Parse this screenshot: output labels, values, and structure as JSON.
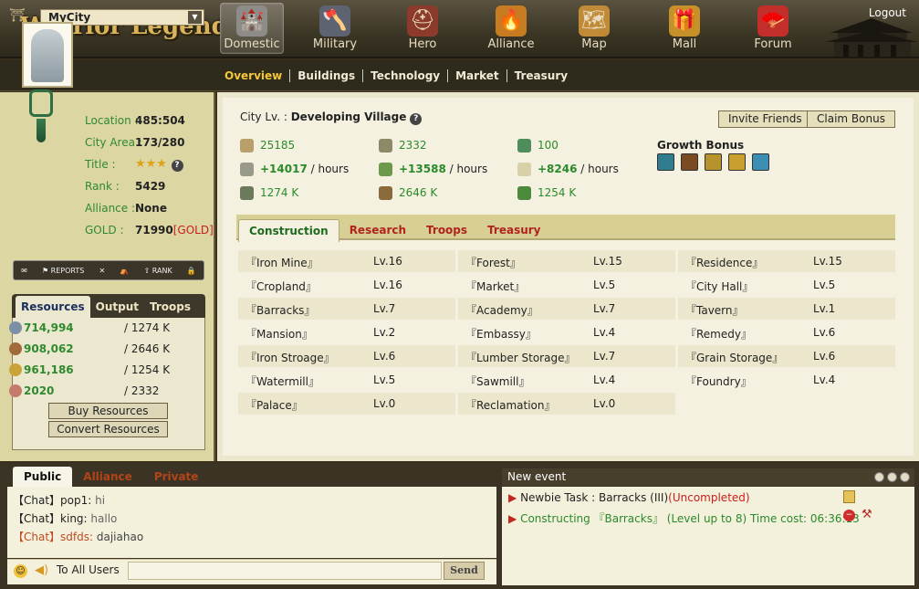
{
  "app": {
    "logo": "Warrior Legends",
    "logout": "Logout"
  },
  "nav": [
    {
      "label": "Domestic",
      "icon": "castle-icon",
      "active": true
    },
    {
      "label": "Military",
      "icon": "axe-icon"
    },
    {
      "label": "Hero",
      "icon": "helmet-icon"
    },
    {
      "label": "Alliance",
      "icon": "fire-icon"
    },
    {
      "label": "Map",
      "icon": "scroll-map-icon"
    },
    {
      "label": "Mall",
      "icon": "treasure-chest-icon"
    },
    {
      "label": "Forum",
      "icon": "fan-icon"
    }
  ],
  "city_select": {
    "value": "MyCity"
  },
  "subnav": [
    "Overview",
    "Buildings",
    "Technology",
    "Market",
    "Treasury"
  ],
  "profile": {
    "location_label": "Location :",
    "location": "485:504",
    "area_label": "City Area :",
    "area": "173/280",
    "title_label": "Title :",
    "title_stars": 3,
    "rank_label": "Rank :",
    "rank": "5429",
    "alliance_label": "Alliance :",
    "alliance": "None",
    "gold_label": "GOLD :",
    "gold": "71990",
    "gold_link": "[GOLD]"
  },
  "toolbar": [
    "REPORTS",
    "RANK"
  ],
  "res_tabs": [
    "Resources",
    "Output",
    "Troops"
  ],
  "resources": [
    {
      "value": "714,994",
      "cap": "/  1274 K",
      "icon": "stone-icon"
    },
    {
      "value": "908,062",
      "cap": "/  2646 K",
      "icon": "wood-icon"
    },
    {
      "value": "961,186",
      "cap": "/  1254 K",
      "icon": "food-icon"
    },
    {
      "value": "2020",
      "cap": "/  2332",
      "icon": "population-icon"
    }
  ],
  "res_buttons": {
    "buy": "Buy Resources",
    "convert": "Convert Resources"
  },
  "city": {
    "lv_label": "City Lv. :",
    "lv": "Developing Village",
    "invite": "Invite Friends",
    "claim": "Claim Bonus"
  },
  "stats": {
    "row1": [
      "25185",
      "2332",
      "100"
    ],
    "row2": [
      "+14017",
      "+13588",
      "+8246"
    ],
    "per_hour": " / hours",
    "row3": [
      "1274 K",
      "2646 K",
      "1254 K"
    ]
  },
  "growth_bonus": {
    "label": "Growth Bonus",
    "colors": [
      "#2f7d8f",
      "#7a4a22",
      "#b7932e",
      "#c9a030",
      "#3c8fb3"
    ]
  },
  "btabs": [
    "Construction",
    "Research",
    "Troops",
    "Treasury"
  ],
  "buildings": [
    [
      {
        "name": "『Iron Mine』",
        "lv": "Lv.16"
      },
      {
        "name": "『Forest』",
        "lv": "Lv.15"
      },
      {
        "name": "『Residence』",
        "lv": "Lv.15"
      }
    ],
    [
      {
        "name": "『Cropland』",
        "lv": "Lv.16"
      },
      {
        "name": "『Market』",
        "lv": "Lv.5"
      },
      {
        "name": "『City Hall』",
        "lv": "Lv.5"
      }
    ],
    [
      {
        "name": "『Barracks』",
        "lv": "Lv.7"
      },
      {
        "name": "『Academy』",
        "lv": "Lv.7"
      },
      {
        "name": "『Tavern』",
        "lv": "Lv.1"
      }
    ],
    [
      {
        "name": "『Mansion』",
        "lv": "Lv.2"
      },
      {
        "name": "『Embassy』",
        "lv": "Lv.4"
      },
      {
        "name": "『Remedy』",
        "lv": "Lv.6"
      }
    ],
    [
      {
        "name": "『Iron Stroage』",
        "lv": "Lv.6"
      },
      {
        "name": "『Lumber Storage』",
        "lv": "Lv.7"
      },
      {
        "name": "『Grain Storage』",
        "lv": "Lv.6"
      }
    ],
    [
      {
        "name": "『Watermill』",
        "lv": "Lv.5"
      },
      {
        "name": "『Sawmill』",
        "lv": "Lv.4"
      },
      {
        "name": "『Foundry』",
        "lv": "Lv.4"
      }
    ],
    [
      {
        "name": "『Palace』",
        "lv": "Lv.0"
      },
      {
        "name": "『Reclamation』",
        "lv": "Lv.0"
      },
      null
    ]
  ],
  "chat": {
    "tabs": [
      "Public",
      "Alliance",
      "Private"
    ],
    "lines": [
      {
        "tag": "【Chat】",
        "user": "pop1:",
        "msg": " hi",
        "alt": false
      },
      {
        "tag": "【Chat】",
        "user": "king:",
        "msg": " hallo",
        "alt": false
      },
      {
        "tag": "【Chat】",
        "user": "sdfds:",
        "msg": " dajiahao",
        "alt": true
      }
    ],
    "to_all": "To All Users",
    "send": "Send"
  },
  "events": {
    "title": "New event",
    "line1_pre": "Newbie Task : Barracks (III)",
    "line1_status": "(Uncompleted)",
    "line2": "Constructing 『Barracks』 (Level up to 8) Time cost: 06:36:13"
  }
}
